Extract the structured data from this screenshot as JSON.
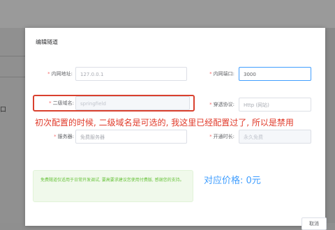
{
  "dialog": {
    "title": "编辑隧道"
  },
  "form": {
    "local_addr": {
      "label": "内网地址:",
      "value": "127.0.0.1"
    },
    "local_port": {
      "label": "内网端口:",
      "value": "3000"
    },
    "subdomain": {
      "label": "二级域名:",
      "placeholder": "springfield"
    },
    "protocol": {
      "label": "穿透协议:",
      "value": "Http (网站)"
    },
    "server": {
      "label": "服务器:",
      "placeholder": "免费服务器"
    },
    "open_time": {
      "label": "开通时长:",
      "value": "永久免费"
    }
  },
  "annotation": "初次配置的时候, 二级域名是可选的, 我这里已经配置过了, 所以是禁用",
  "tip": {
    "text": "免费隧道仅适用于日常开发调试, 要高要求建议您使用付费版, 感谢您的支持。"
  },
  "price": "对应价格: 0元",
  "footer": {
    "cancel_label": "取消"
  },
  "colors": {
    "required": "#f56c6c",
    "highlight": "#d9402e",
    "annotation": "#e03a2a",
    "price": "#409eff",
    "tip_bg": "#f0f9eb"
  }
}
